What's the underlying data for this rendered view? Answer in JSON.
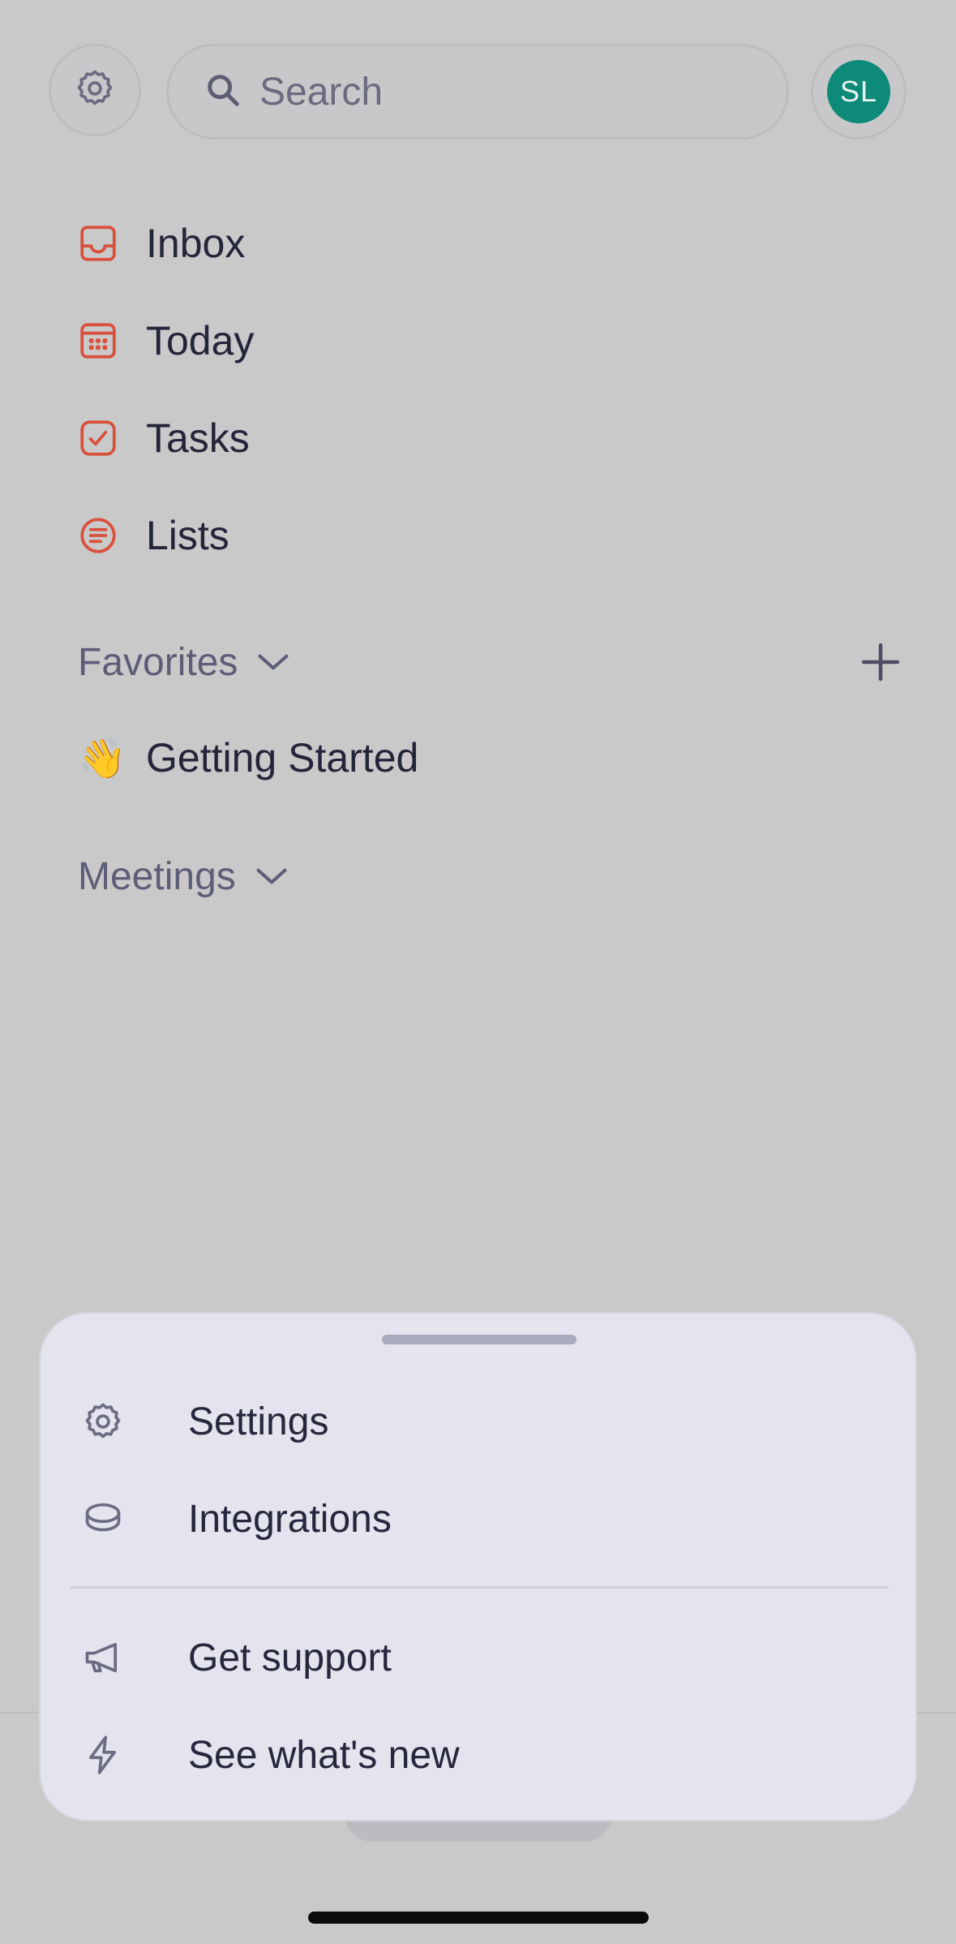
{
  "header": {
    "search_placeholder": "Search",
    "avatar_initials": "SL",
    "avatar_color": "#0d8a78"
  },
  "nav": {
    "items": [
      {
        "label": "Inbox",
        "icon": "inbox-icon"
      },
      {
        "label": "Today",
        "icon": "calendar-icon"
      },
      {
        "label": "Tasks",
        "icon": "checkbox-icon"
      },
      {
        "label": "Lists",
        "icon": "list-icon"
      }
    ],
    "accent_color": "#d9503c"
  },
  "favorites": {
    "title": "Favorites",
    "items": [
      {
        "emoji": "👋",
        "label": "Getting Started"
      }
    ]
  },
  "meetings": {
    "title": "Meetings"
  },
  "menu_sheet": {
    "items": [
      {
        "label": "Settings",
        "icon": "gear-icon"
      },
      {
        "label": "Integrations",
        "icon": "layers-icon"
      },
      {
        "label": "Get support",
        "icon": "megaphone-icon"
      },
      {
        "label": "See what's new",
        "icon": "lightning-icon"
      }
    ]
  }
}
